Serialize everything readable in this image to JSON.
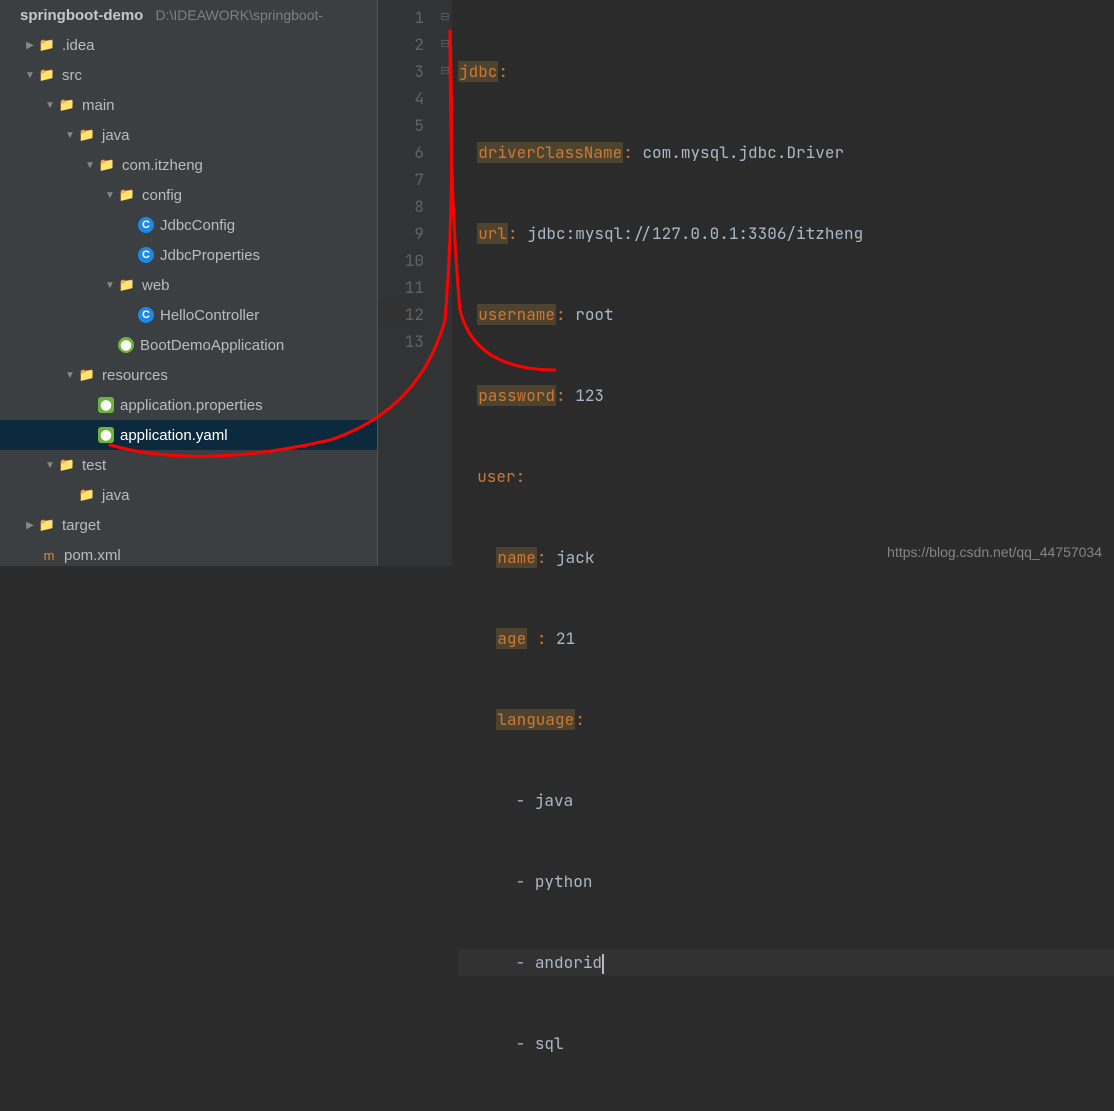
{
  "project": {
    "name": "springboot-demo",
    "path": "D:\\IDEAWORK\\springboot-"
  },
  "tree": {
    "idea": ".idea",
    "src": "src",
    "main": "main",
    "java": "java",
    "pkg": "com.itzheng",
    "config": "config",
    "jdbcConfig": "JdbcConfig",
    "jdbcProps": "JdbcProperties",
    "web": "web",
    "hello": "HelloController",
    "bootApp": "BootDemoApplication",
    "resources": "resources",
    "appProps": "application.properties",
    "appYaml": "application.yaml",
    "test": "test",
    "testJava": "java",
    "target": "target",
    "pom": "pom.xml"
  },
  "editor": {
    "lines": [
      "1",
      "2",
      "3",
      "4",
      "5",
      "6",
      "7",
      "8",
      "9",
      "10",
      "11",
      "12",
      "13"
    ],
    "jdbc": "jdbc",
    "driverKey": "driverClassName",
    "driverVal": "com.mysql.jdbc.Driver",
    "urlKey": "url",
    "urlVal": "jdbc:mysql://127.0.0.1:3306/itzheng",
    "userKey": "username",
    "userVal": "root",
    "passKey": "password",
    "passVal": "123",
    "userTop": "user",
    "nameKey": "name",
    "nameVal": "jack",
    "ageKey": "age",
    "ageVal": "21",
    "langKey": "language",
    "lang1": "java",
    "lang2": "python",
    "lang3": "andorid",
    "lang4": "sql"
  },
  "watermark": "https://blog.csdn.net/qq_44757034"
}
